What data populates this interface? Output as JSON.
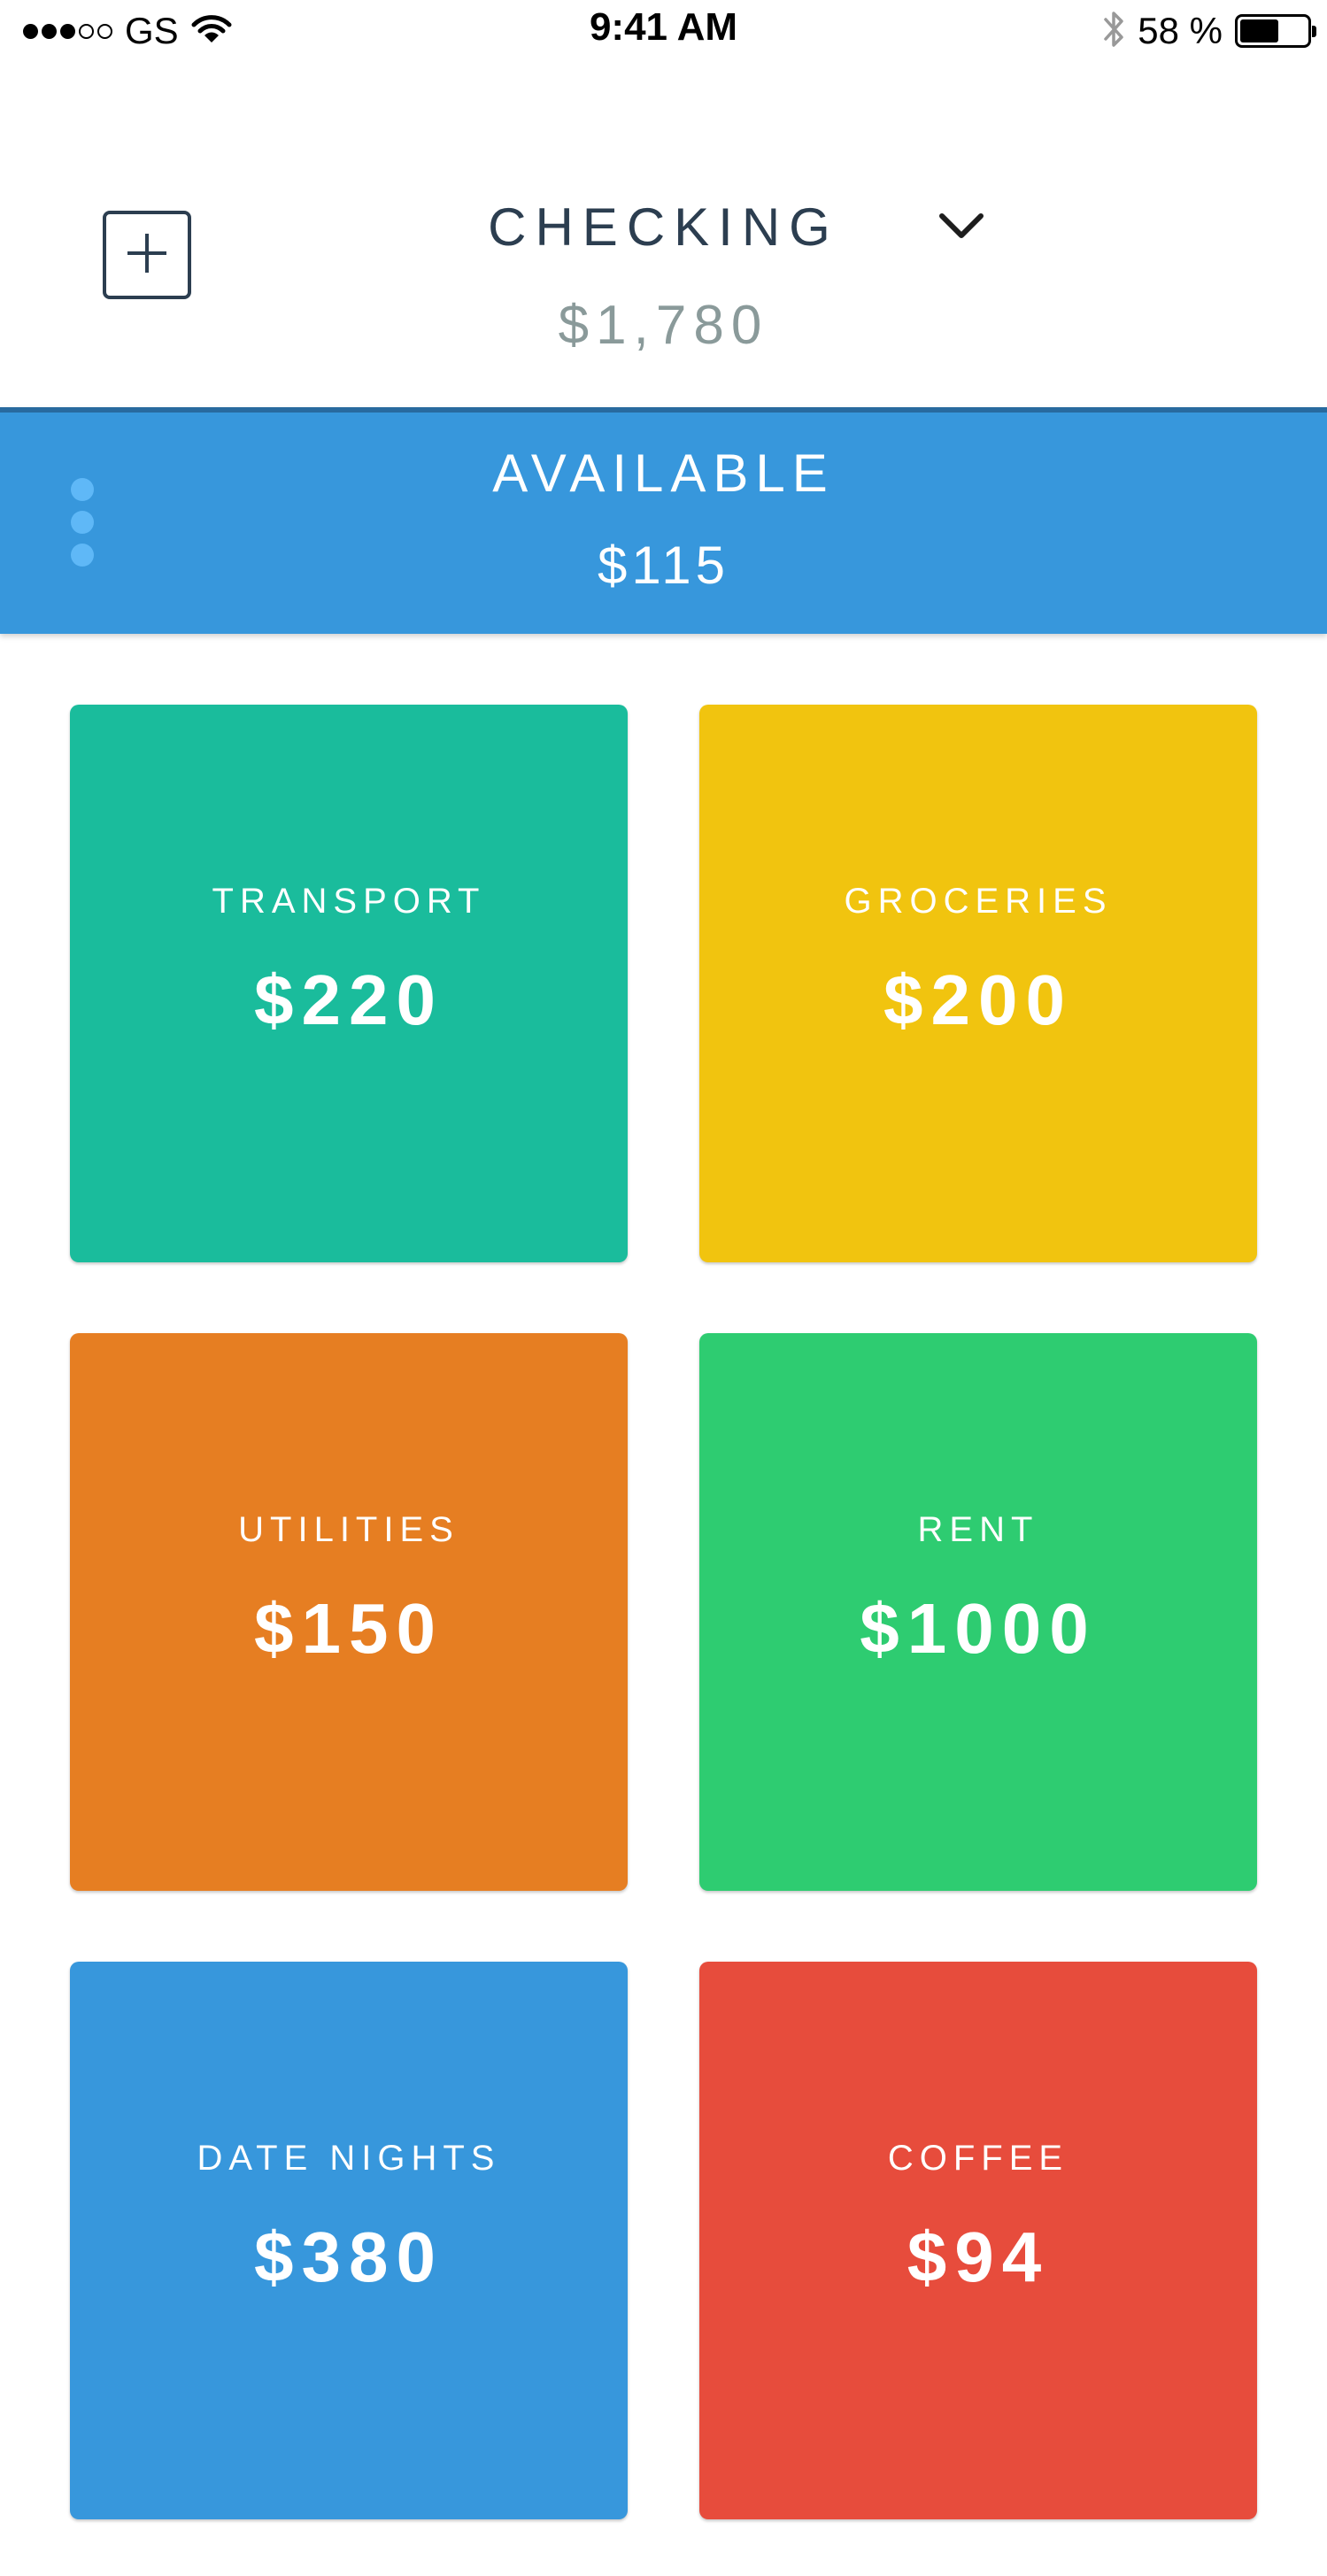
{
  "status_bar": {
    "carrier": "GS",
    "time": "9:41 AM",
    "battery_percent": "58 %",
    "battery_level": 0.58,
    "signal_bars_filled": 3,
    "signal_bars_total": 5,
    "icons": [
      "wifi-icon",
      "bluetooth-icon",
      "battery-icon"
    ]
  },
  "header": {
    "add_icon": "plus-square-icon",
    "account_name": "CHECKING",
    "dropdown_icon": "chevron-down-icon",
    "account_balance": "$1,780"
  },
  "available": {
    "label": "AVAILABLE",
    "amount": "$115",
    "menu_icon": "more-vertical-icon",
    "background_color": "#3797dc"
  },
  "categories": [
    {
      "name": "TRANSPORT",
      "amount": "$220",
      "color": "#1abc9c"
    },
    {
      "name": "GROCERIES",
      "amount": "$200",
      "color": "#f1c40f"
    },
    {
      "name": "UTILITIES",
      "amount": "$150",
      "color": "#e67e22"
    },
    {
      "name": "RENT",
      "amount": "$1000",
      "color": "#2ecc71"
    },
    {
      "name": "DATE NIGHTS",
      "amount": "$380",
      "color": "#3797dc"
    },
    {
      "name": "COFFEE",
      "amount": "$94",
      "color": "#e74c3c"
    }
  ]
}
